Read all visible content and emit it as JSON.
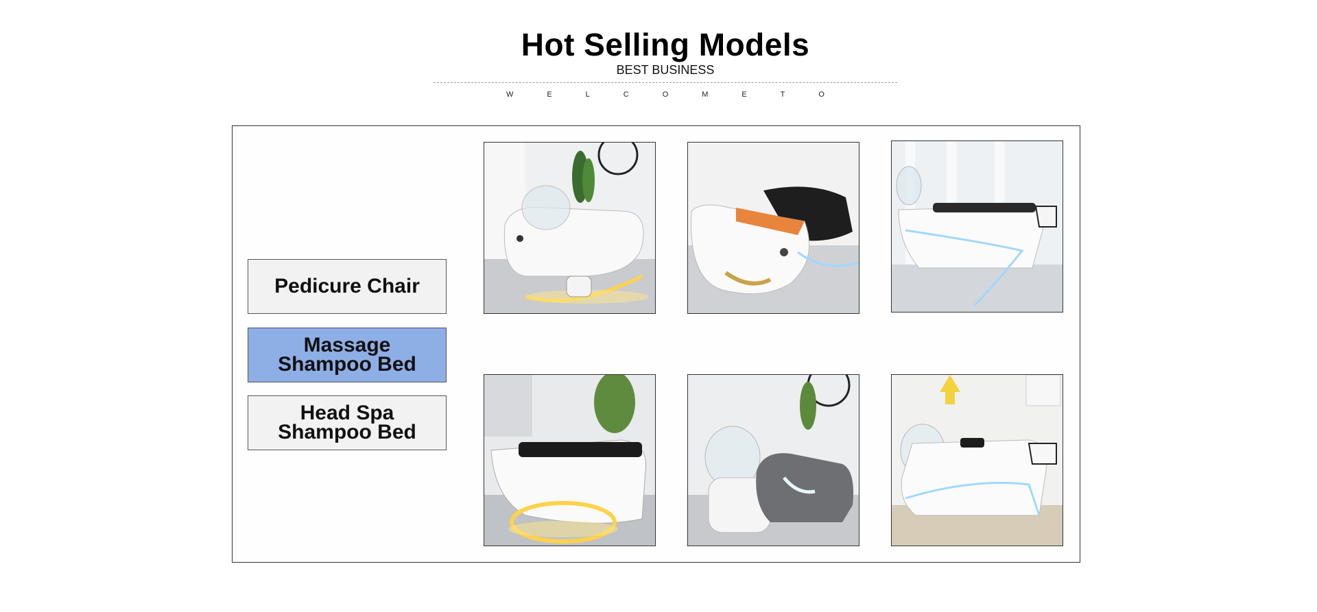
{
  "header": {
    "title": "Hot Selling Models",
    "subtitle": "BEST BUSINESS",
    "welcome_letters": [
      "W",
      "E",
      "L",
      "C",
      "O",
      "M",
      "E",
      "T",
      "O"
    ]
  },
  "categories": [
    {
      "label": "Pedicure Chair",
      "active": false
    },
    {
      "label": "Massage\nShampoo Bed",
      "active": true
    },
    {
      "label": "Head Spa\nShampoo Bed",
      "active": false
    }
  ],
  "colors": {
    "active_category": "#8eaee6",
    "inactive_category": "#f2f2f2",
    "led_warm": "#ffd24a",
    "led_cool": "#9fd8ff"
  },
  "products": [
    {
      "icon": "shampoo-bed-white-dome-warm-led-photo"
    },
    {
      "icon": "shampoo-beds-orange-black-photo"
    },
    {
      "icon": "shampoo-bed-white-cool-led-photo"
    },
    {
      "icon": "shampoo-bed-oval-warm-led-photo"
    },
    {
      "icon": "shampoo-bed-grey-dome-photo"
    },
    {
      "icon": "shampoo-bed-white-blue-led-photo"
    }
  ]
}
